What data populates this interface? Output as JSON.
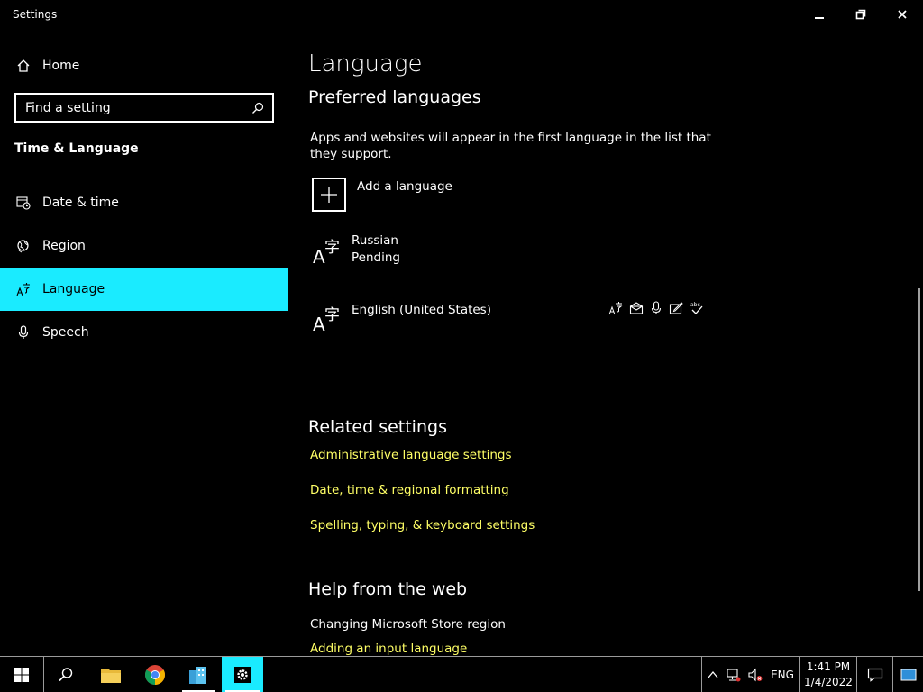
{
  "window": {
    "title": "Settings"
  },
  "sidebar": {
    "home_label": "Home",
    "search_placeholder": "Find a setting",
    "section_title": "Time & Language",
    "items": [
      {
        "label": "Date & time",
        "icon": "calendar-clock-icon"
      },
      {
        "label": "Region",
        "icon": "globe-icon"
      },
      {
        "label": "Language",
        "icon": "language-icon",
        "active": true
      },
      {
        "label": "Speech",
        "icon": "microphone-icon"
      }
    ]
  },
  "main": {
    "title": "Language",
    "preferred_heading": "Preferred languages",
    "preferred_desc": "Apps and websites will appear in the first language in the list that they support.",
    "add_language_label": "Add a language",
    "languages": [
      {
        "name": "Russian",
        "status": "Pending"
      },
      {
        "name": "English (United States)",
        "status": ""
      }
    ],
    "feature_icons": [
      "display-language-icon",
      "language-pack-icon",
      "speech-icon",
      "handwriting-icon",
      "spelling-icon"
    ],
    "related_heading": "Related settings",
    "related_links": [
      "Administrative language settings",
      "Date, time & regional formatting",
      "Spelling, typing, & keyboard settings"
    ],
    "help_heading": "Help from the web",
    "help_items": [
      {
        "label": "Changing Microsoft Store region",
        "link": false
      },
      {
        "label": "Adding an input language",
        "link": true
      }
    ]
  },
  "taskbar": {
    "apps": [
      "start-icon",
      "search-icon",
      "file-explorer-icon",
      "chrome-icon",
      "server-manager-icon",
      "settings-icon"
    ],
    "language": "ENG",
    "time": "1:41 PM",
    "date": "1/4/2022"
  },
  "colors": {
    "accent": "#1aebff",
    "link": "#ffff66",
    "background": "#000000"
  }
}
